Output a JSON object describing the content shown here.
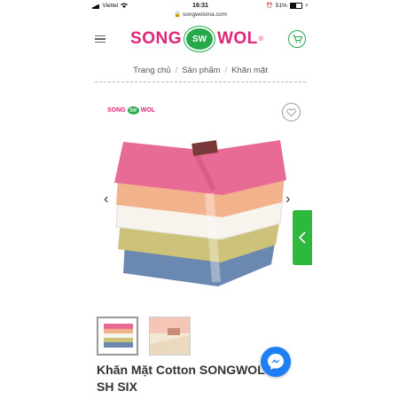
{
  "status_bar": {
    "carrier": "Viettel",
    "time": "16:31",
    "battery": "51%"
  },
  "address_bar": {
    "url": "songwolvina.com"
  },
  "header": {
    "logo_left": "SONG",
    "logo_badge": "SW",
    "logo_right": "WOL",
    "logo_reg": "®"
  },
  "breadcrumb": {
    "items": [
      "Trang chủ",
      "Sản phẩm",
      "Khăn mặt"
    ],
    "separator": "/"
  },
  "product_image": {
    "watermark_left": "SONG",
    "watermark_badge": "SW",
    "watermark_right": "WOL",
    "towel_colors": [
      "#e86b95",
      "#f2b38c",
      "#f7f4ee",
      "#cdc279",
      "#6b88b0"
    ]
  },
  "product": {
    "title_line1": "Khăn Mặt Cotton SONGWOL",
    "title_line2": "SH SIX",
    "thumbnail_count": 2
  },
  "colors": {
    "brand_pink": "#e0247a",
    "brand_green": "#27a84a",
    "messenger_blue": "#1e7ff5"
  },
  "icons": [
    "hamburger-icon",
    "cart-icon",
    "heart-icon",
    "chevron-left-icon",
    "chevron-right-icon",
    "messenger-icon"
  ]
}
